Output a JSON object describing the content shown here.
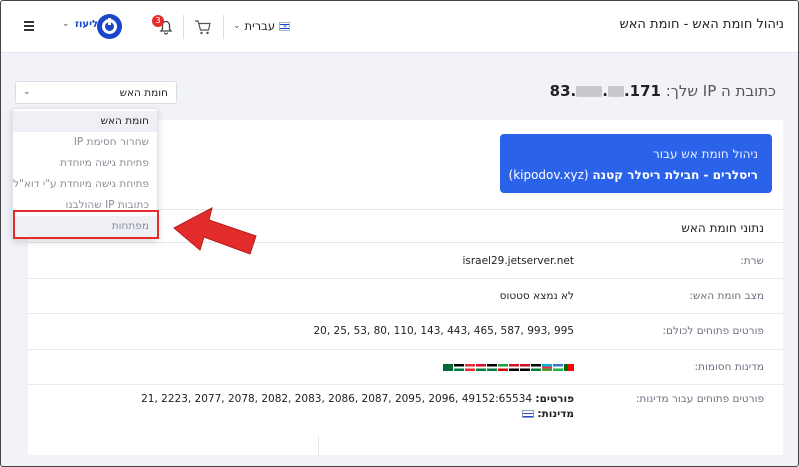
{
  "header": {
    "title": "ניהול חומת האש - חומת האש",
    "language": "עברית",
    "brand_label": "ליעוז",
    "notifications_count": "3"
  },
  "section_select": {
    "value": "חומת האש"
  },
  "ip": {
    "label": "כתובת ה IP שלך:",
    "value_prefix": "83.",
    "value_suffix": ".171",
    "dot": "."
  },
  "menu": {
    "items": [
      {
        "label": "חומת האש"
      },
      {
        "label": "שחרור חסימת IP"
      },
      {
        "label": "פתיחת גישה מיוחדת"
      },
      {
        "label": "פתיחת גישה מיוחדת ע\"י דוא\"ל"
      },
      {
        "label": "כתובות IP שהולבנו"
      },
      {
        "label": "מפתחות"
      }
    ]
  },
  "info_box": {
    "line1": "ניהול חומת אש עבור",
    "line2_bold": "ריסלרים - חבילת ריסלר קטנה",
    "line2_domain": "(kipodov.xyz)"
  },
  "section_title": "נתוני חומת האש",
  "rows": {
    "server_key": "שרת:",
    "server_val": "israel29.jetserver.net",
    "status_key": "מצב חומת האש:",
    "status_val": "לא נמצא סטטוס",
    "open_ports_key": "פורטים פתוחים לכולם:",
    "open_ports_val": "20, 25, 53, 80, 110, 143, 443, 465, 587, 993, 995",
    "blocked_key": "מדינות חסומות:",
    "country_ports_key": "פורטים פתוחים עבור מדינות:",
    "country_ports_label": "פורטים:",
    "country_ports_val": "21, 2223, 2077, 2078, 2082, 2083, 2086, 2087, 2095, 2096, 49152:65534",
    "countries_label": "מדינות:"
  },
  "colors": {
    "accent_blue": "#2a63ea",
    "highlight_red": "#e22b2b",
    "badge_red": "#e42d2d"
  },
  "icons": [
    "hamburger-icon",
    "power-logo-icon",
    "bell-icon",
    "cart-icon",
    "israel-flag-icon",
    "chevron-down-icon",
    "red-arrow-icon"
  ]
}
